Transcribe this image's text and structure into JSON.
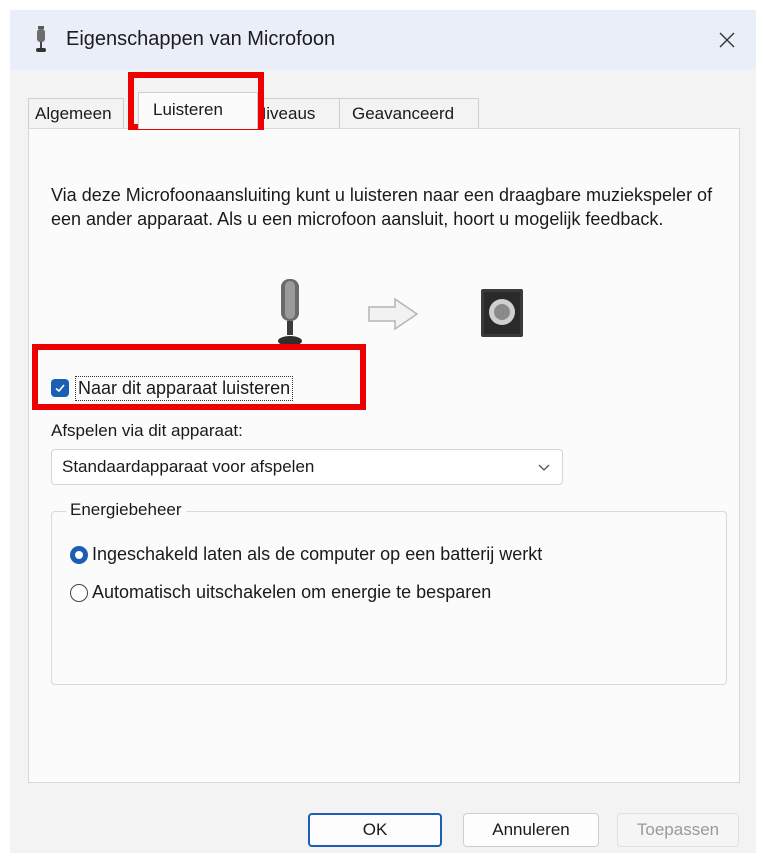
{
  "window": {
    "title": "Eigenschappen van Microfoon",
    "close_icon": "close-icon"
  },
  "tabs": [
    {
      "label": "Algemeen",
      "active": false
    },
    {
      "label": "Luisteren",
      "active": true
    },
    {
      "label": "Niveaus",
      "active": false
    },
    {
      "label": "Geavanceerd",
      "active": false
    }
  ],
  "listen": {
    "description": "Via deze Microfoonaansluiting kunt u luisteren naar een draagbare muziekspeler of een ander apparaat. Als u een microfoon aansluit, hoort u mogelijk feedback.",
    "icons": [
      "microphone-icon",
      "arrow-right-icon",
      "speaker-icon"
    ],
    "checkbox_label": "Naar dit apparaat luisteren",
    "checkbox_checked": true,
    "playback_label": "Afspelen via dit apparaat:",
    "playback_device": "Standaardapparaat voor afspelen"
  },
  "power": {
    "legend": "Energiebeheer",
    "options": [
      {
        "label": "Ingeschakeld laten als de computer op een batterij werkt",
        "selected": true
      },
      {
        "label": "Automatisch uitschakelen om energie te besparen",
        "selected": false
      }
    ]
  },
  "buttons": {
    "ok": "OK",
    "cancel": "Annuleren",
    "apply": "Toepassen"
  },
  "colors": {
    "accent": "#1a5fb4",
    "highlight": "#ee0000",
    "titlebar": "#e9eef8"
  }
}
